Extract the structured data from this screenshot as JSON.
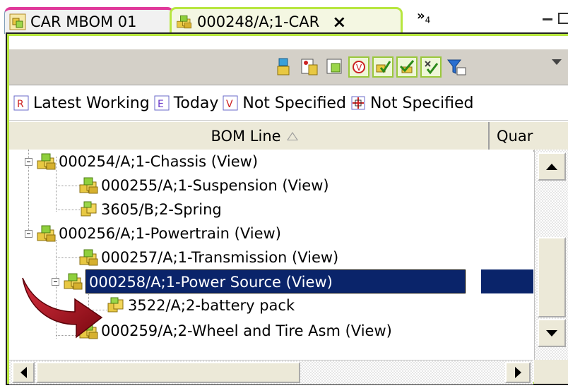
{
  "tabs": [
    {
      "label": "CAR MBOM 01",
      "icon": "bom-view-icon",
      "active": false
    },
    {
      "label": "000248/A;1-CAR",
      "icon": "assembly-icon",
      "active": true,
      "close": "×"
    }
  ],
  "overflow": {
    "chevron": "»",
    "count": "4"
  },
  "toolbar": {
    "buttons": [
      "structure-icon",
      "properties-icon",
      "edit-icon",
      "filter-v-icon",
      "check-icon",
      "add-icon",
      "validate-icon",
      "column-filter-icon"
    ]
  },
  "revision_rules": [
    {
      "label": "Latest Working",
      "icon": "revision-rule-icon"
    },
    {
      "label": "Today",
      "icon": "effectivity-date-icon"
    },
    {
      "label": "Not Specified",
      "icon": "variant-rule-icon"
    },
    {
      "label": "Not Specified",
      "icon": "closure-rule-icon"
    }
  ],
  "columns": {
    "bom_line": "BOM Line",
    "quantity": "Quar"
  },
  "tree": [
    {
      "label": "000254/A;1-Chassis (View)",
      "level": 0,
      "expanded": true
    },
    {
      "label": "000255/A;1-Suspension (View)",
      "level": 1
    },
    {
      "label": "3605/B;2-Spring",
      "level": 1
    },
    {
      "label": "000256/A;1-Powertrain (View)",
      "level": 0,
      "expanded": true
    },
    {
      "label": "000257/A;1-Transmission (View)",
      "level": 1
    },
    {
      "label": "000258/A;1-Power Source (View)",
      "level": 1,
      "expanded": true,
      "selected": true
    },
    {
      "label": "3522/A;2-battery pack",
      "level": 2
    },
    {
      "label": "000259/A;2-Wheel and Tire Asm (View)",
      "level": 1
    }
  ],
  "colors": {
    "active_tab_border": "#b7e63f",
    "inactive_tab_accent": "#e0389a",
    "selection": "#0a246a",
    "annotation_arrow": "#a0101a"
  }
}
